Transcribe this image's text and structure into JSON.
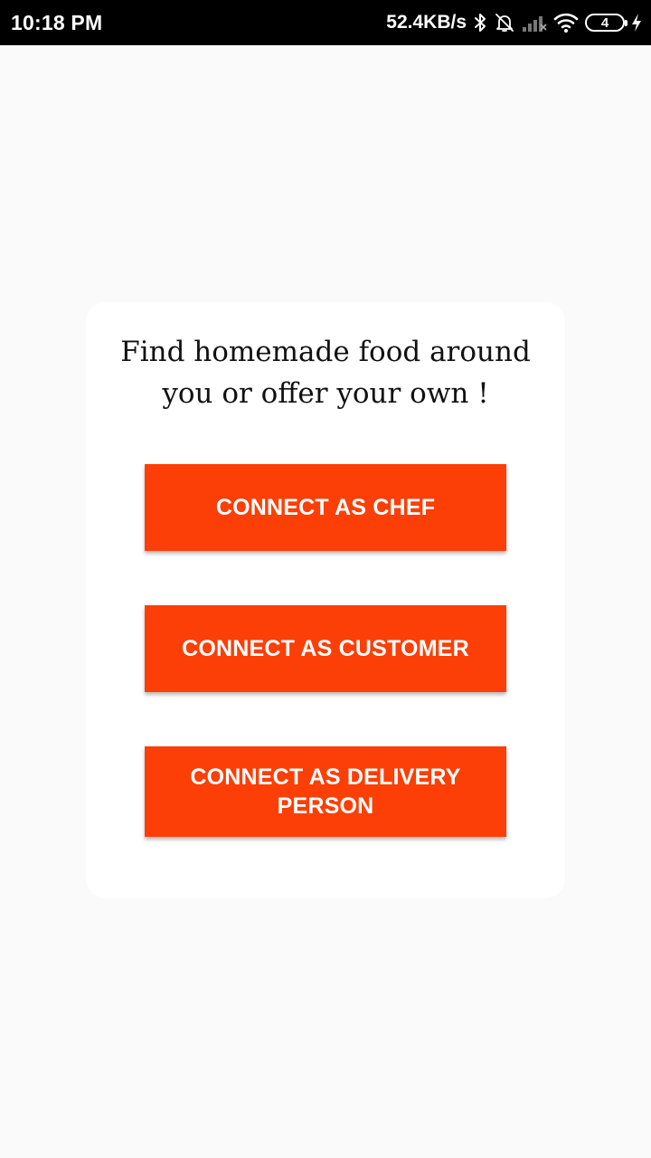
{
  "status_bar": {
    "time": "10:18 PM",
    "network_speed": "52.4KB/s",
    "battery_level": "4",
    "icons": [
      "bluetooth-icon",
      "bell-off-icon",
      "signal-icon",
      "wifi-icon",
      "battery-icon",
      "charging-icon"
    ]
  },
  "card": {
    "tagline": "Find homemade food around you or offer your own !"
  },
  "buttons": {
    "chef": "CONNECT AS CHEF",
    "customer": "CONNECT AS CUSTOMER",
    "delivery": "CONNECT AS DELIVERY PERSON"
  },
  "colors": {
    "accent": "#fc3f06",
    "background": "#fafafa",
    "card": "#ffffff",
    "status_bar": "#000000"
  }
}
